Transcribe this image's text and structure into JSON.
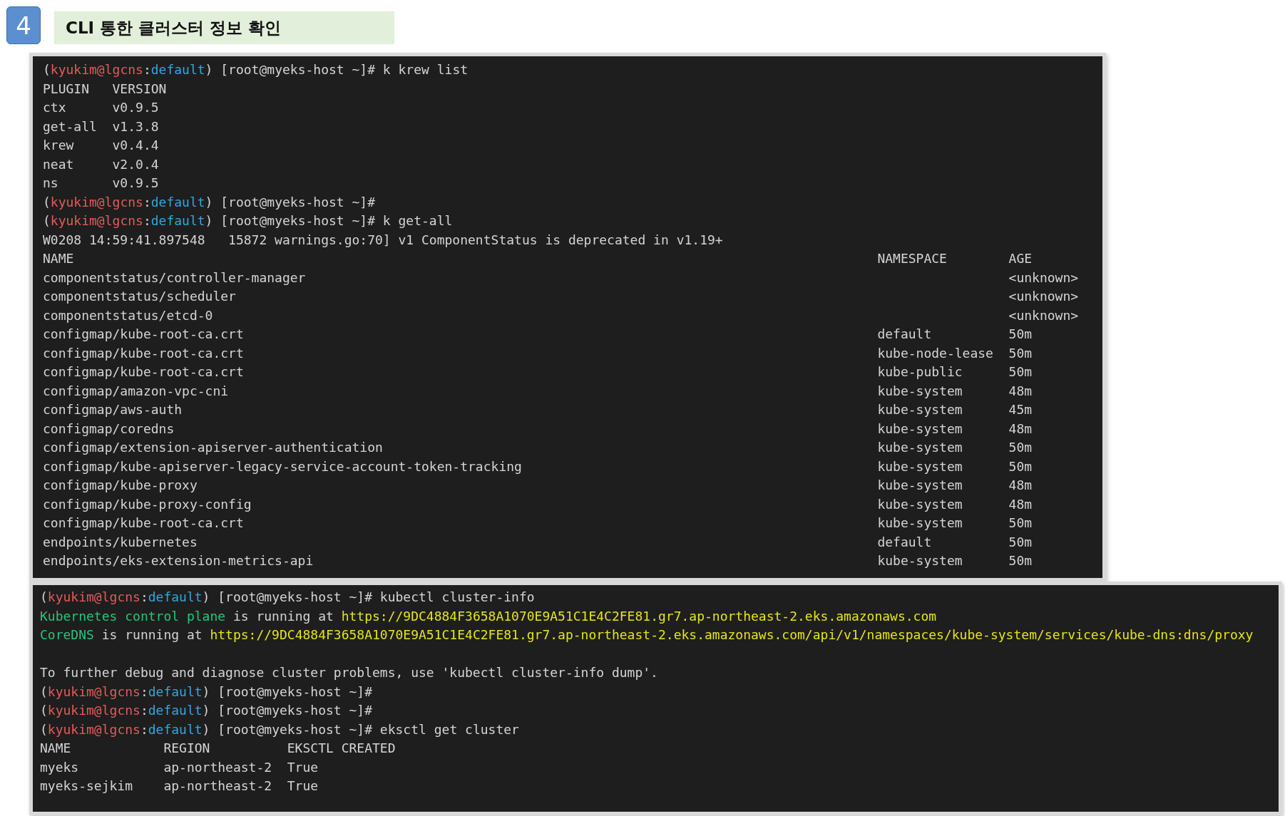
{
  "step": {
    "number": "4",
    "title": "CLI 통한 클러스터 정보 확인"
  },
  "terminals": [
    {
      "blocks": [
        {
          "kind": "line",
          "segments": [
            {
              "kind": "plain",
              "text": "("
            },
            {
              "kind": "user",
              "text": "kyukim@lgcns"
            },
            {
              "kind": "plain",
              "text": ":"
            },
            {
              "kind": "ctx",
              "text": "default"
            },
            {
              "kind": "plain",
              "text": ") [root@myeks-host ~]# k krew list"
            }
          ]
        },
        {
          "kind": "table",
          "columns": [
            "PLUGIN",
            "VERSION"
          ],
          "rows": [
            [
              "ctx",
              "v0.9.5"
            ],
            [
              "get-all",
              "v1.3.8"
            ],
            [
              "krew",
              "v0.4.4"
            ],
            [
              "neat",
              "v2.0.4"
            ],
            [
              "ns",
              "v0.9.5"
            ]
          ]
        },
        {
          "kind": "line",
          "segments": [
            {
              "kind": "plain",
              "text": "("
            },
            {
              "kind": "user",
              "text": "kyukim@lgcns"
            },
            {
              "kind": "plain",
              "text": ":"
            },
            {
              "kind": "ctx",
              "text": "default"
            },
            {
              "kind": "plain",
              "text": ") [root@myeks-host ~]#"
            }
          ]
        },
        {
          "kind": "line",
          "segments": [
            {
              "kind": "plain",
              "text": "("
            },
            {
              "kind": "user",
              "text": "kyukim@lgcns"
            },
            {
              "kind": "plain",
              "text": ":"
            },
            {
              "kind": "ctx",
              "text": "default"
            },
            {
              "kind": "plain",
              "text": ") [root@myeks-host ~]# k get-all"
            }
          ]
        },
        {
          "kind": "line",
          "segments": [
            {
              "kind": "plain",
              "text": "W0208 14:59:41.897548   15872 warnings.go:70] v1 ComponentStatus is deprecated in v1.19+"
            }
          ]
        },
        {
          "kind": "table",
          "columns": [
            "NAME",
            "NAMESPACE",
            "AGE"
          ],
          "rows": [
            [
              "componentstatus/controller-manager",
              null,
              "<unknown>"
            ],
            [
              "componentstatus/scheduler",
              null,
              "<unknown>"
            ],
            [
              "componentstatus/etcd-0",
              null,
              "<unknown>"
            ],
            [
              "configmap/kube-root-ca.crt",
              "default",
              "50m"
            ],
            [
              "configmap/kube-root-ca.crt",
              "kube-node-lease",
              "50m"
            ],
            [
              "configmap/kube-root-ca.crt",
              "kube-public",
              "50m"
            ],
            [
              "configmap/amazon-vpc-cni",
              "kube-system",
              "48m"
            ],
            [
              "configmap/aws-auth",
              "kube-system",
              "45m"
            ],
            [
              "configmap/coredns",
              "kube-system",
              "48m"
            ],
            [
              "configmap/extension-apiserver-authentication",
              "kube-system",
              "50m"
            ],
            [
              "configmap/kube-apiserver-legacy-service-account-token-tracking",
              "kube-system",
              "50m"
            ],
            [
              "configmap/kube-proxy",
              "kube-system",
              "48m"
            ],
            [
              "configmap/kube-proxy-config",
              "kube-system",
              "48m"
            ],
            [
              "configmap/kube-root-ca.crt",
              "kube-system",
              "50m"
            ],
            [
              "endpoints/kubernetes",
              "default",
              "50m"
            ],
            [
              "endpoints/eks-extension-metrics-api",
              "kube-system",
              "50m"
            ]
          ]
        }
      ]
    },
    {
      "blocks": [
        {
          "kind": "line",
          "segments": [
            {
              "kind": "plain",
              "text": "("
            },
            {
              "kind": "user",
              "text": "kyukim@lgcns"
            },
            {
              "kind": "plain",
              "text": ":"
            },
            {
              "kind": "ctx",
              "text": "default"
            },
            {
              "kind": "plain",
              "text": ") [root@myeks-host ~]# kubectl cluster-info"
            }
          ]
        },
        {
          "kind": "line",
          "segments": [
            {
              "kind": "label",
              "text": "Kubernetes control plane"
            },
            {
              "kind": "plain",
              "text": " is running at "
            },
            {
              "kind": "url",
              "text": "https://9DC4884F3658A1070E9A51C1E4C2FE81.gr7.ap-northeast-2.eks.amazonaws.com"
            }
          ]
        },
        {
          "kind": "line",
          "segments": [
            {
              "kind": "label",
              "text": "CoreDNS"
            },
            {
              "kind": "plain",
              "text": " is running at "
            },
            {
              "kind": "url",
              "text": "https://9DC4884F3658A1070E9A51C1E4C2FE81.gr7.ap-northeast-2.eks.amazonaws.com/api/v1/namespaces/kube-system/services/kube-dns:dns/proxy"
            }
          ]
        },
        {
          "kind": "blank"
        },
        {
          "kind": "line",
          "segments": [
            {
              "kind": "plain",
              "text": "To further debug and diagnose cluster problems, use 'kubectl cluster-info dump'."
            }
          ]
        },
        {
          "kind": "line",
          "segments": [
            {
              "kind": "plain",
              "text": "("
            },
            {
              "kind": "user",
              "text": "kyukim@lgcns"
            },
            {
              "kind": "plain",
              "text": ":"
            },
            {
              "kind": "ctx",
              "text": "default"
            },
            {
              "kind": "plain",
              "text": ") [root@myeks-host ~]#"
            }
          ]
        },
        {
          "kind": "line",
          "segments": [
            {
              "kind": "plain",
              "text": "("
            },
            {
              "kind": "user",
              "text": "kyukim@lgcns"
            },
            {
              "kind": "plain",
              "text": ":"
            },
            {
              "kind": "ctx",
              "text": "default"
            },
            {
              "kind": "plain",
              "text": ") [root@myeks-host ~]#"
            }
          ]
        },
        {
          "kind": "line",
          "segments": [
            {
              "kind": "plain",
              "text": "("
            },
            {
              "kind": "user",
              "text": "kyukim@lgcns"
            },
            {
              "kind": "plain",
              "text": ":"
            },
            {
              "kind": "ctx",
              "text": "default"
            },
            {
              "kind": "plain",
              "text": ") [root@myeks-host ~]# eksctl get cluster"
            }
          ]
        },
        {
          "kind": "table",
          "columns": [
            "NAME",
            "REGION",
            "EKSCTL CREATED"
          ],
          "rows": [
            [
              "myeks",
              "ap-northeast-2",
              "True"
            ],
            [
              "myeks-sejkim",
              "ap-northeast-2",
              "True"
            ]
          ]
        }
      ]
    }
  ]
}
